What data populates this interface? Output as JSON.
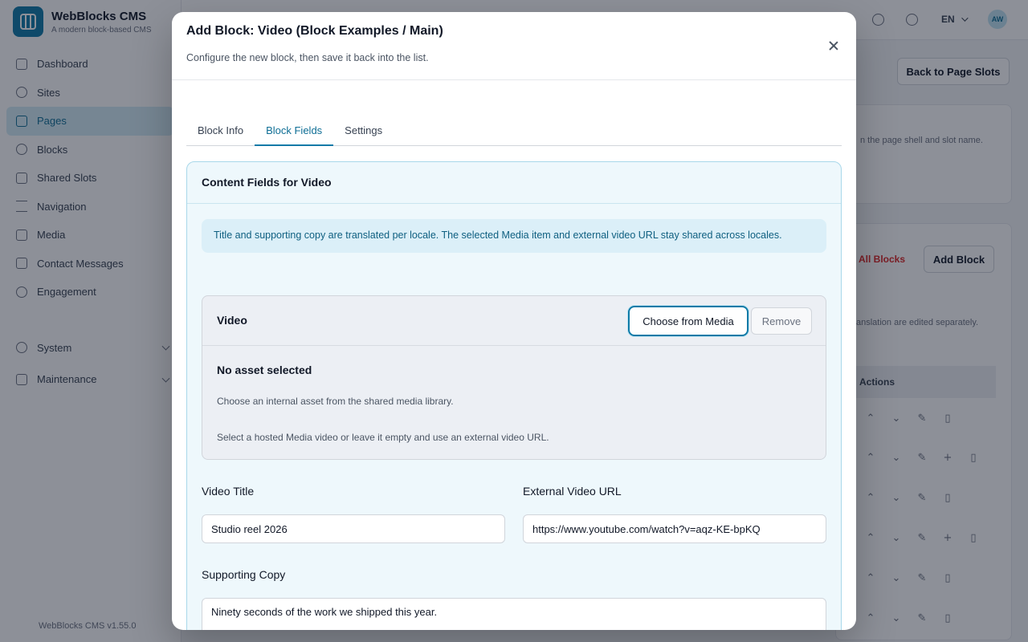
{
  "app": {
    "name": "WebBlocks CMS",
    "tagline": "A modern block-based CMS",
    "version": "WebBlocks CMS v1.55.0",
    "language": "EN",
    "avatar_initials": "AW"
  },
  "sidebar": {
    "items": [
      {
        "label": "Dashboard",
        "icon": "dashboard-icon"
      },
      {
        "label": "Sites",
        "icon": "globe-icon"
      },
      {
        "label": "Pages",
        "icon": "page-icon",
        "active": true
      },
      {
        "label": "Blocks",
        "icon": "blocks-icon"
      },
      {
        "label": "Shared Slots",
        "icon": "layers-icon"
      },
      {
        "label": "Navigation",
        "icon": "menu-icon"
      },
      {
        "label": "Media",
        "icon": "image-icon"
      },
      {
        "label": "Contact Messages",
        "icon": "mail-icon"
      },
      {
        "label": "Engagement",
        "icon": "star-icon"
      }
    ],
    "groups": [
      {
        "label": "System",
        "icon": "gear-icon"
      },
      {
        "label": "Maintenance",
        "icon": "wrench-icon"
      }
    ]
  },
  "background": {
    "back_button": "Back to Page Slots",
    "hint_text": "n the page shell and slot name.",
    "delete_all": "All Blocks",
    "add_block": "Add Block",
    "translation_text": "anslation are edited separately.",
    "actions_header": "Actions"
  },
  "modal": {
    "title": "Add Block: Video (Block Examples / Main)",
    "subtitle": "Configure the new block, then save it back into the list.",
    "tabs": [
      {
        "label": "Block Info"
      },
      {
        "label": "Block Fields",
        "active": true
      },
      {
        "label": "Settings"
      }
    ],
    "fields_title": "Content Fields for Video",
    "info_text": "Title and supporting copy are translated per locale. The selected Media item and external video URL stay shared across locales.",
    "media": {
      "title": "Video",
      "choose_label": "Choose from Media",
      "remove_label": "Remove",
      "empty_title": "No asset selected",
      "help_1": "Choose an internal asset from the shared media library.",
      "help_2": "Select a hosted Media video or leave it empty and use an external video URL."
    },
    "video_title": {
      "label": "Video Title",
      "value": "Studio reel 2026"
    },
    "external_url": {
      "label": "External Video URL",
      "value": "https://www.youtube.com/watch?v=aqz-KE-bpKQ"
    },
    "supporting_copy": {
      "label": "Supporting Copy",
      "value": "Ninety seconds of the work we shipped this year."
    }
  },
  "colors": {
    "accent": "#0e7aa7",
    "overlay": "rgba(17,24,39,0.48)",
    "danger": "#dc2626"
  }
}
